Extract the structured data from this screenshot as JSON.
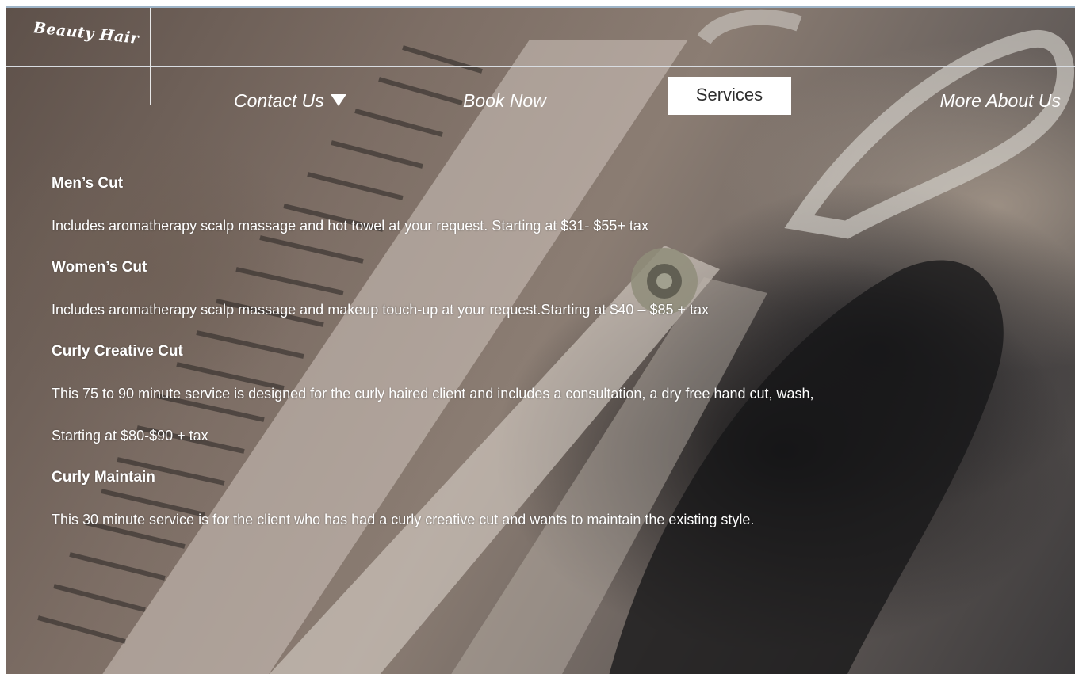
{
  "brand": {
    "logo": "Beauty Hair"
  },
  "nav": {
    "contact": "Contact Us",
    "book": "Book Now",
    "services": "Services",
    "more": "More About Us"
  },
  "services": [
    {
      "title": "Men’s Cut",
      "desc": "Includes aromatherapy scalp massage and hot towel at your request. Starting at $31- $55+ tax"
    },
    {
      "title": "Women’s Cut",
      "desc": "Includes aromatherapy scalp massage and makeup touch-up at your request.Starting at $40 – $85 + tax"
    },
    {
      "title": "Curly Creative Cut",
      "desc": "This 75 to 90 minute service is designed for the curly haired client and includes a consultation, a dry free hand  cut, wash,",
      "desc2": "Starting at $80-$90 + tax"
    },
    {
      "title": "Curly Maintain",
      "desc": "This 30 minute service is for the client who has had a curly creative cut and wants to maintain the existing style."
    }
  ],
  "icons": {
    "dropdown": "triangle-down-icon"
  }
}
